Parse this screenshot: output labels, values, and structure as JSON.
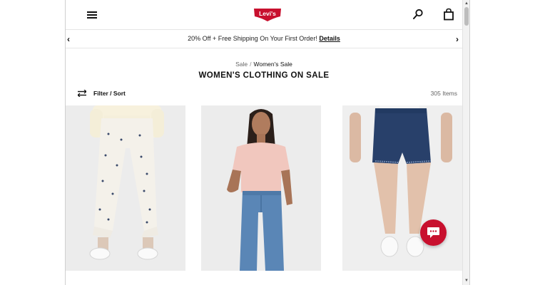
{
  "header": {
    "logo_text": "Levi's",
    "brand_color": "#c8102e",
    "menu_icon": "hamburger-menu-icon",
    "search_icon": "search-icon",
    "bag_icon": "shopping-bag-icon"
  },
  "promo": {
    "text": "20% Off + Free Shipping On Your First Order!",
    "link": "Details",
    "prev_arrow": "‹",
    "next_arrow": "›"
  },
  "breadcrumb": {
    "parent": "Sale",
    "separator": "/",
    "current": "Women's Sale"
  },
  "page": {
    "title": "WOMEN'S CLOTHING ON SALE"
  },
  "toolbar": {
    "filter_label": "Filter / Sort",
    "item_count": "305 Items"
  },
  "products": [
    {
      "image": "model-white-printed-jeans"
    },
    {
      "image": "model-pink-tee-blue-jeans"
    },
    {
      "image": "model-dark-denim-shorts"
    }
  ],
  "chat": {
    "icon": "chat-bubble-icon",
    "color": "#c8102e"
  }
}
